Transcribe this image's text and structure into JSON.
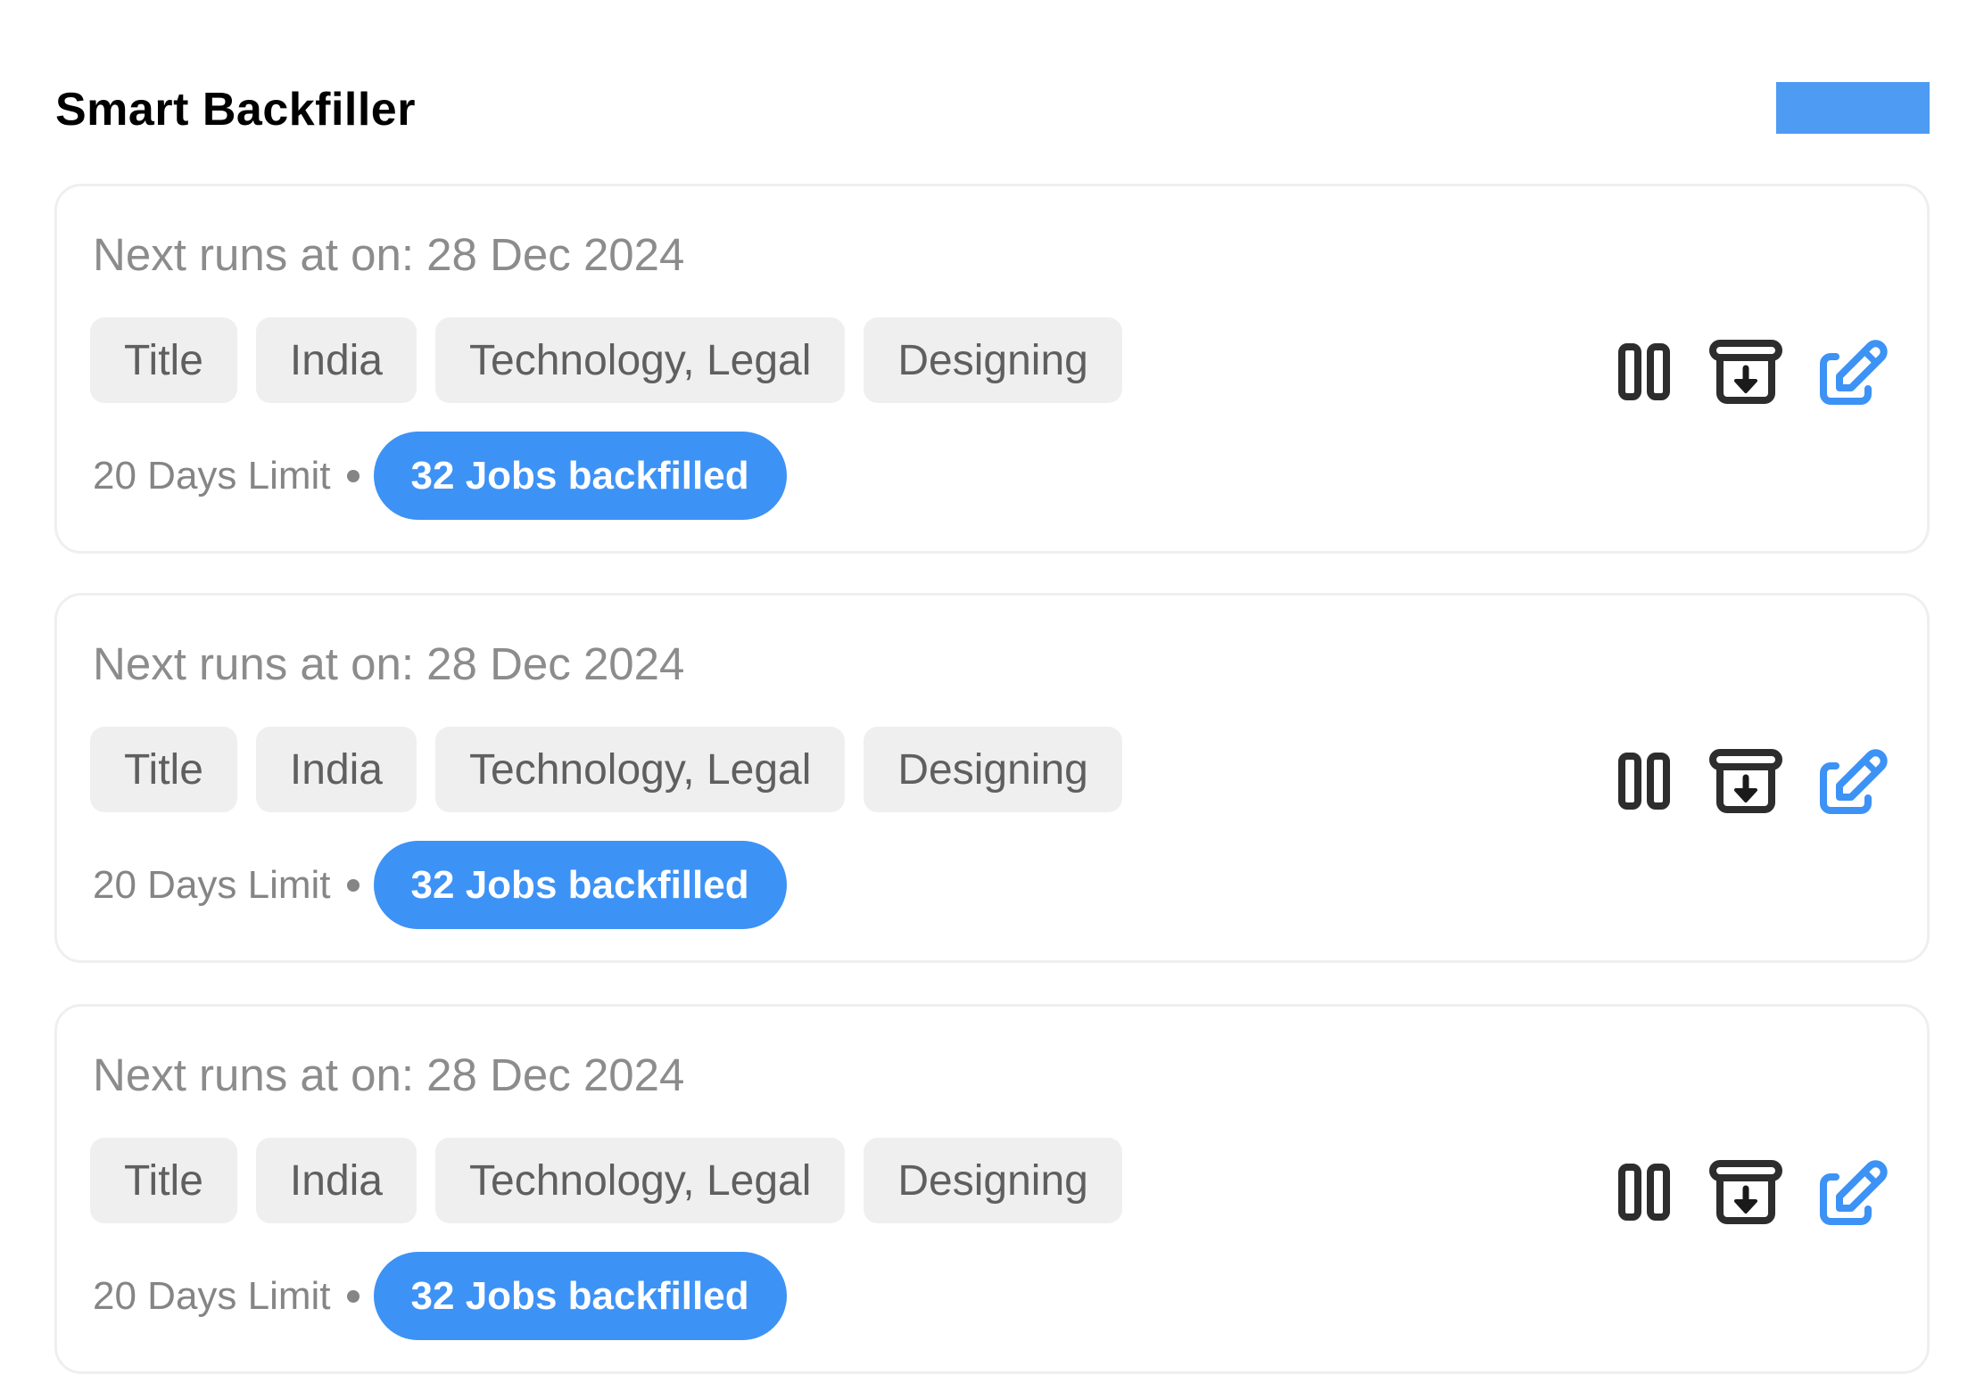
{
  "header": {
    "title": "Smart Backfiller",
    "action_button_label": ""
  },
  "colors": {
    "accent": "#3d92f5",
    "header_button": "#4e9bf4",
    "tag_bg": "#efefef",
    "icon_dark": "#2d2d2d"
  },
  "cards": [
    {
      "next_run_label": "Next runs at on: 28 Dec 2024",
      "tags": [
        "Title",
        "India",
        "Technology, Legal",
        "Designing"
      ],
      "limit": "20 Days Limit",
      "badge": "32 Jobs backfilled",
      "actions": [
        "pause-icon",
        "archive-icon",
        "edit-icon"
      ]
    },
    {
      "next_run_label": "Next runs at on: 28 Dec 2024",
      "tags": [
        "Title",
        "India",
        "Technology, Legal",
        "Designing"
      ],
      "limit": "20 Days Limit",
      "badge": "32 Jobs backfilled",
      "actions": [
        "pause-icon",
        "archive-icon",
        "edit-icon"
      ]
    },
    {
      "next_run_label": "Next runs at on: 28 Dec 2024",
      "tags": [
        "Title",
        "India",
        "Technology, Legal",
        "Designing"
      ],
      "limit": "20 Days Limit",
      "badge": "32 Jobs backfilled",
      "actions": [
        "pause-icon",
        "archive-icon",
        "edit-icon"
      ]
    }
  ]
}
